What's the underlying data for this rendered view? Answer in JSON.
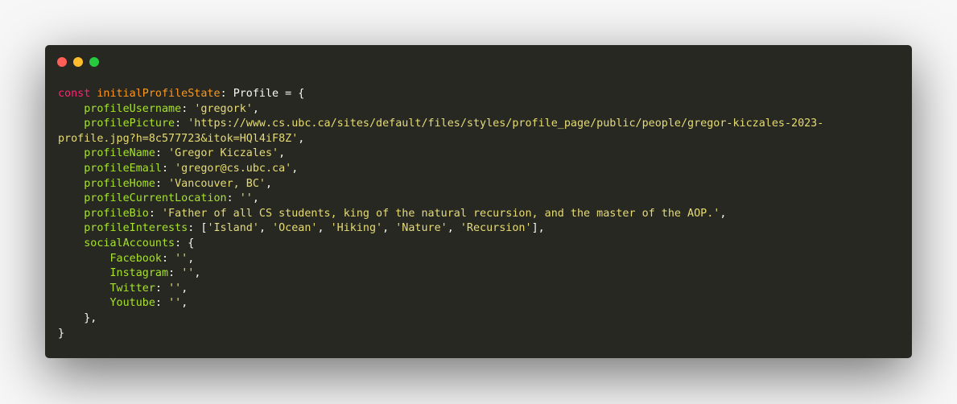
{
  "window": {
    "controls": [
      {
        "name": "close",
        "color": "#ff5f56"
      },
      {
        "name": "minimize",
        "color": "#ffbd2e"
      },
      {
        "name": "maximize",
        "color": "#27c93f"
      }
    ]
  },
  "code": {
    "keyword_const": "const",
    "variable": "initialProfileState",
    "type": "Profile",
    "props": {
      "profileUsername": "profileUsername",
      "profilePicture": "profilePicture",
      "profileName": "profileName",
      "profileEmail": "profileEmail",
      "profileHome": "profileHome",
      "profileCurrentLocation": "profileCurrentLocation",
      "profileBio": "profileBio",
      "profileInterests": "profileInterests",
      "socialAccounts": "socialAccounts",
      "facebook": "Facebook",
      "instagram": "Instagram",
      "twitter": "Twitter",
      "youtube": "Youtube"
    },
    "values": {
      "username": "'gregork'",
      "picture_part1": "'https://www.cs.ubc.ca/sites/default/files/styles/profile_page/public/people/gregor-kiczales-2023-",
      "picture_part2": "profile.jpg?h=8c577723&itok=HQl4iF8Z'",
      "name": "'Gregor Kiczales'",
      "email": "'gregor@cs.ubc.ca'",
      "home": "'Vancouver, BC'",
      "current_location": "''",
      "bio": "'Father of all CS students, king of the natural recursion, and the master of the AOP.'",
      "interests": [
        "'Island'",
        "'Ocean'",
        "'Hiking'",
        "'Nature'",
        "'Recursion'"
      ],
      "facebook": "''",
      "instagram": "''",
      "twitter": "''",
      "youtube": "''"
    }
  }
}
